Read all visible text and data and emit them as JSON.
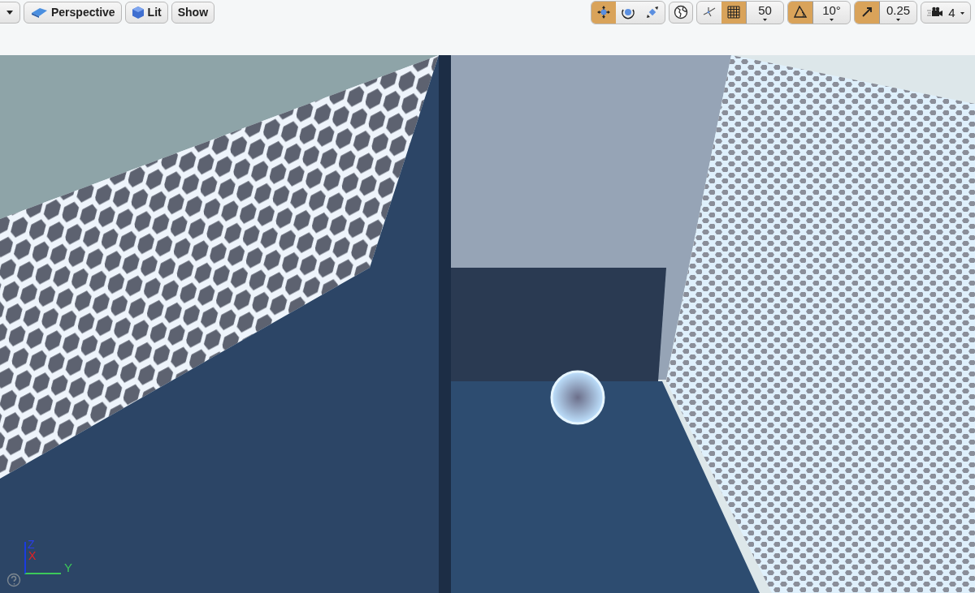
{
  "toolbar": {
    "left": [
      {
        "kind": "menu"
      },
      {
        "kind": "perspective",
        "label": "Perspective"
      },
      {
        "kind": "lit",
        "label": "Lit"
      },
      {
        "kind": "plain",
        "label": "Show"
      }
    ],
    "transform_tools": [
      {
        "kind": "translate",
        "selected": true
      },
      {
        "kind": "rotate",
        "selected": false
      },
      {
        "kind": "scale",
        "selected": false
      }
    ],
    "snaps": [
      {
        "on": true,
        "value": "50"
      },
      {
        "on": true,
        "value": "10°"
      },
      {
        "on": true,
        "value": "0.25"
      }
    ],
    "surface_snap": {
      "on": false
    },
    "camera_speed": "4"
  },
  "axis_gizmo": {
    "z": "Z",
    "x": "X",
    "y": "Y"
  }
}
